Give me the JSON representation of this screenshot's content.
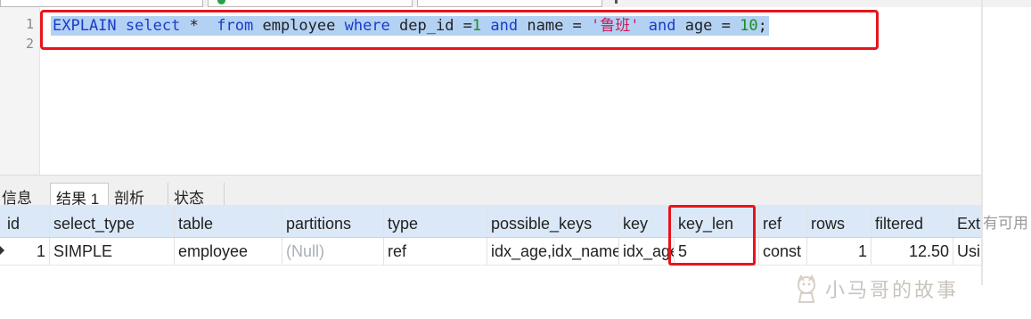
{
  "editor": {
    "line_numbers": [
      "1",
      "2"
    ],
    "sql_tokens": [
      {
        "t": "EXPLAIN",
        "c": "kw"
      },
      {
        "t": " ",
        "c": "op"
      },
      {
        "t": "select",
        "c": "kw"
      },
      {
        "t": " *  ",
        "c": "op"
      },
      {
        "t": "from",
        "c": "kw"
      },
      {
        "t": " employee ",
        "c": "op"
      },
      {
        "t": "where",
        "c": "kw"
      },
      {
        "t": " dep_id =",
        "c": "op"
      },
      {
        "t": "1",
        "c": "num"
      },
      {
        "t": " ",
        "c": "op"
      },
      {
        "t": "and",
        "c": "kw"
      },
      {
        "t": " name = ",
        "c": "op"
      },
      {
        "t": "'鲁班'",
        "c": "str"
      },
      {
        "t": " ",
        "c": "op"
      },
      {
        "t": "and",
        "c": "kw"
      },
      {
        "t": " age = ",
        "c": "op"
      },
      {
        "t": "10",
        "c": "num"
      },
      {
        "t": ";",
        "c": "op"
      }
    ]
  },
  "tabs": [
    {
      "label": "信息",
      "active": false
    },
    {
      "label": "结果 1",
      "active": true
    },
    {
      "label": "剖析",
      "active": false
    },
    {
      "label": "状态",
      "active": false
    }
  ],
  "grid": {
    "columns": [
      "id",
      "select_type",
      "table",
      "partitions",
      "type",
      "possible_keys",
      "key",
      "key_len",
      "ref",
      "rows",
      "filtered",
      "Ext"
    ],
    "rows": [
      [
        "1",
        "SIMPLE",
        "employee",
        "(Null)",
        "ref",
        "idx_age,idx_name",
        "idx_age",
        "5",
        "const",
        "1",
        "12.50",
        "Usi"
      ]
    ]
  },
  "side_text": "有可用",
  "watermark": "小马哥的故事",
  "colors": {
    "highlight_box": "#e8141c",
    "selection": "#b3d1f3",
    "header_bg": "#dbe8f7"
  }
}
